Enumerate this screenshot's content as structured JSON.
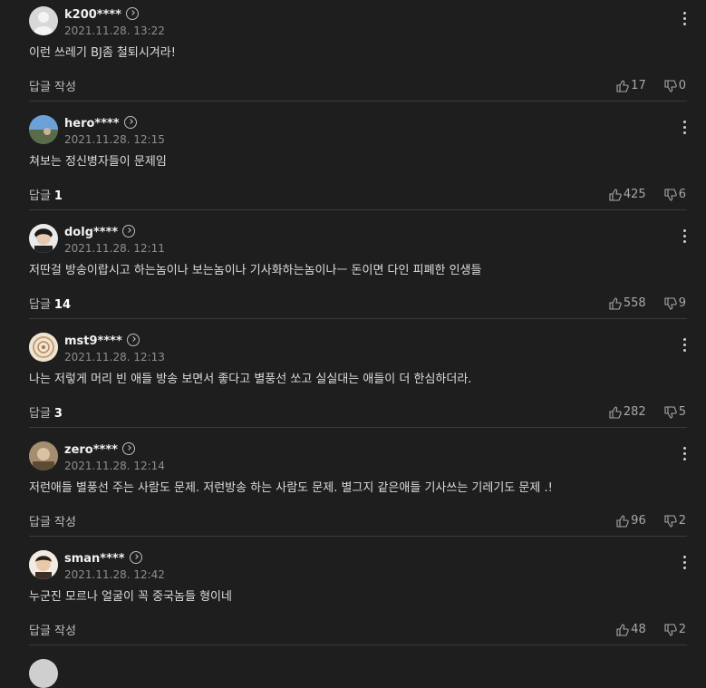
{
  "comments": [
    {
      "user": "k200****",
      "date": "2021.11.28. 13:22",
      "text": "이런 쓰레기 BJ좀 철퇴시겨라!",
      "reply_label": "답글 작성",
      "reply_count": "",
      "likes": "17",
      "dislikes": "0",
      "avatar_color": "#d8d8d8"
    },
    {
      "user": "hero****",
      "date": "2021.11.28. 12:15",
      "text": "쳐보는 정신병자들이 문제임",
      "reply_label": "답글",
      "reply_count": "1",
      "likes": "425",
      "dislikes": "6",
      "avatar_color": "#4a7bb0"
    },
    {
      "user": "dolg****",
      "date": "2021.11.28. 12:11",
      "text": "저딴걸 방송이랍시고 하는놈이나 보는놈이나 기사화하는놈이나ㅡ 돈이면 다인 피폐한 인생들",
      "reply_label": "답글",
      "reply_count": "14",
      "likes": "558",
      "dislikes": "9",
      "avatar_color": "#2a2a2a"
    },
    {
      "user": "mst9****",
      "date": "2021.11.28. 12:13",
      "text": "나는 저렇게 머리 빈 애들 방송 보면서 좋다고 별풍선 쏘고 실실대는 애들이 더 한심하더라.",
      "reply_label": "답글",
      "reply_count": "3",
      "likes": "282",
      "dislikes": "5",
      "avatar_color": "#d9c3a2"
    },
    {
      "user": "zero****",
      "date": "2021.11.28. 12:14",
      "text": "저런애들 별풍선 주는 사람도 문제. 저런방송 하는 사람도 문제. 별그지 같은애들 기사쓰는 기레기도 문제 .!",
      "reply_label": "답글 작성",
      "reply_count": "",
      "likes": "96",
      "dislikes": "2",
      "avatar_color": "#8a7256"
    },
    {
      "user": "sman****",
      "date": "2021.11.28. 12:42",
      "text": "누군진 모르나 얼굴이 꼭 중국놈들 형이네",
      "reply_label": "답글 작성",
      "reply_count": "",
      "likes": "48",
      "dislikes": "2",
      "avatar_color": "#c9b8a6"
    }
  ]
}
